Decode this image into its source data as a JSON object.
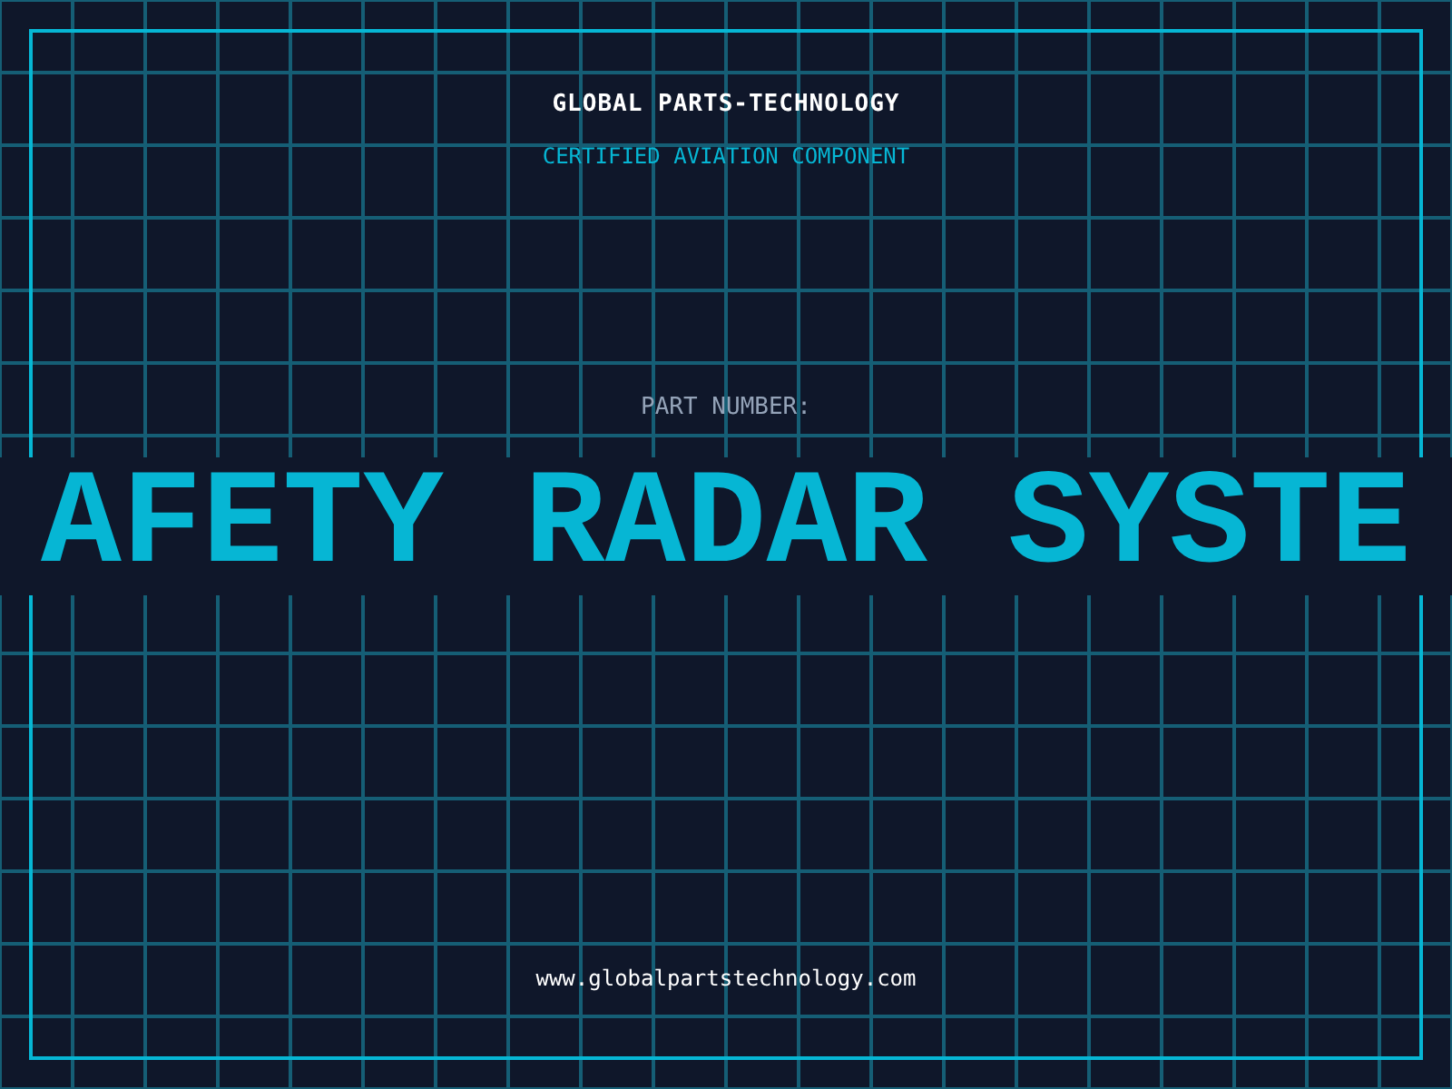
{
  "header": {
    "company": "GLOBAL PARTS-TECHNOLOGY",
    "subtitle": "CERTIFIED AVIATION COMPONENT"
  },
  "part": {
    "label": "PART NUMBER:",
    "value": "AFETY RADAR SYSTE"
  },
  "footer": {
    "url": "www.globalpartstechnology.com"
  }
}
